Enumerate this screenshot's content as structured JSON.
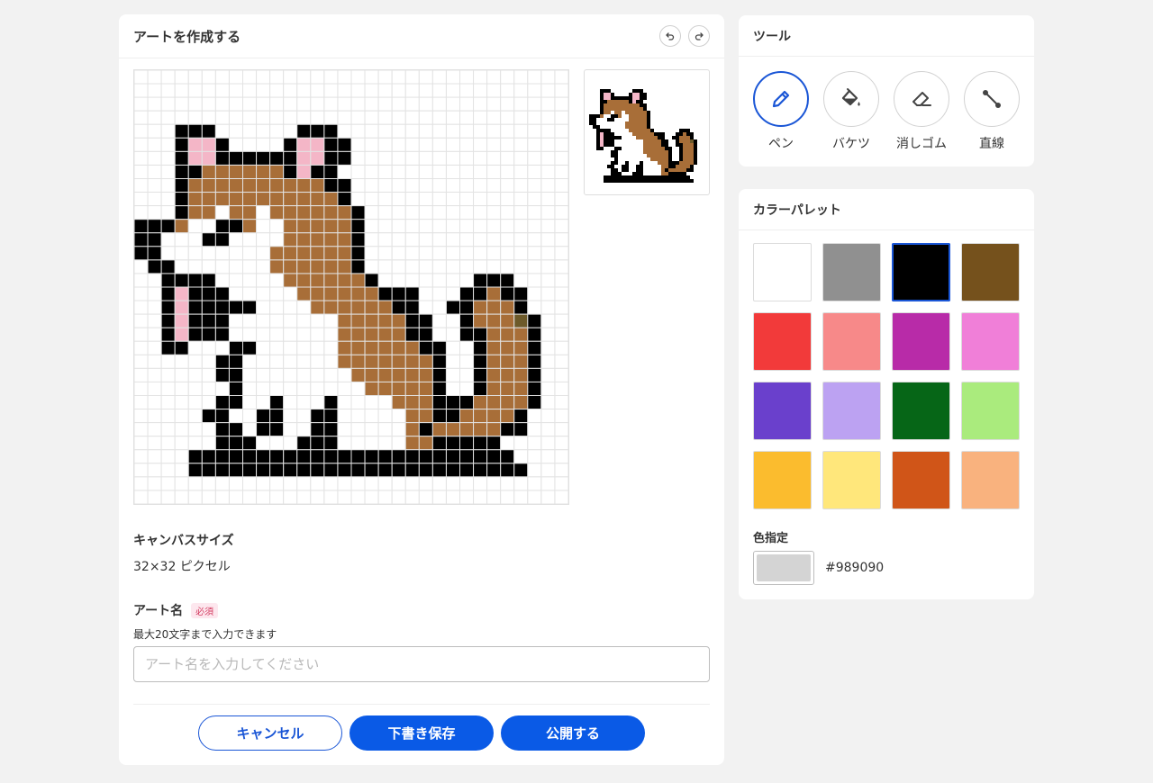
{
  "editor": {
    "title": "アートを作成する",
    "undo_icon": "undo-icon",
    "redo_icon": "redo-icon",
    "canvas": {
      "palette": {
        "W": "#ffffff",
        "K": "#000000",
        "B": "#a86e38",
        "P": "#f4b6c7",
        "D": "#6d5a2a"
      },
      "rows": [
        "................................",
        "................................",
        "................................",
        "................................",
        "...KKK......KKK.................",
        "...KPPK....KPPKK................",
        "...KPPKKKKKKPPKK................",
        "...KKBBBBBBKPKK.................",
        "...KBBBBBBBBBBKK................",
        "...KBBBBBBBBBBBK................",
        "...KBBWBBWBBBBBBK...............",
        "KKKBWWKKBWWBBBBBK...............",
        "KKWWWKKWWWWBBBBBK...............",
        "KKWWWWWWWWBBBBBBK...............",
        ".KKWWWWWWWBBBBBBK...............",
        "..KKKKWWWWWBBBBBBK.......KKK....",
        "..KPKKKWWWWWBBBBBBKKK...KKBKK...",
        "..KPKKKKKWWWWBBBBBBKK..KKBBBK...",
        "..KPKKKWWWWWWWWBBBBBKK..KBBBDK..",
        "..KPKKKWWWWWWWWBBBBBKK..KKBBBK..",
        "..KKWWWKKWWWWWWBBBBBBKK..KBBBK..",
        "......KKWWWWWWWBBBBBBBK..KBBBK..",
        "......KKWWWWWWWWBBBBBBK..KBBBK..",
        ".......KWWWWWWWWWBBBBBK..KBBBK..",
        "......KKWWKWWWKWWWWBBBKKKBBBBK..",
        ".....KKWWKKWWKKWWWWWBBKKBBBBK...",
        "......KKWKKWWKKWWWWWBKBBBBBKK...",
        "......KKKWWWKKKWWWWWBBKKKKK.....",
        "....KKKKKKKKKKKKKKKKKKKKKKKK....",
        "....KKKKKKKKKKKKKKKKKKKKKKKKK...",
        "................................",
        "................................"
      ]
    },
    "canvas_size_label": "キャンバスサイズ",
    "canvas_size_value": "32×32 ピクセル",
    "art_name_label": "アート名",
    "required_badge": "必須",
    "art_name_hint": "最大20文字まで入力できます",
    "art_name_value": "",
    "art_name_placeholder": "アート名を入力してください",
    "buttons": {
      "cancel": "キャンセル",
      "draft": "下書き保存",
      "publish": "公開する"
    }
  },
  "tools": {
    "title": "ツール",
    "items": [
      {
        "label": "ペン",
        "icon": "pen-icon",
        "active": true
      },
      {
        "label": "バケツ",
        "icon": "bucket-icon",
        "active": false
      },
      {
        "label": "消しゴム",
        "icon": "eraser-icon",
        "active": false
      },
      {
        "label": "直線",
        "icon": "line-icon",
        "active": false
      }
    ]
  },
  "palette": {
    "title": "カラーパレット",
    "colors": [
      "#ffffff",
      "#909090",
      "#000000",
      "#75511c",
      "#f23a3a",
      "#f78989",
      "#b82ba8",
      "#f07fd8",
      "#6a40cc",
      "#bca2f2",
      "#066617",
      "#aaeb7d",
      "#fbbc2e",
      "#ffe77b",
      "#d05518",
      "#f9b27e"
    ],
    "selected_index": 2,
    "custom_label": "色指定",
    "custom_color": "#d4d4d4",
    "custom_hex": "#989090"
  }
}
